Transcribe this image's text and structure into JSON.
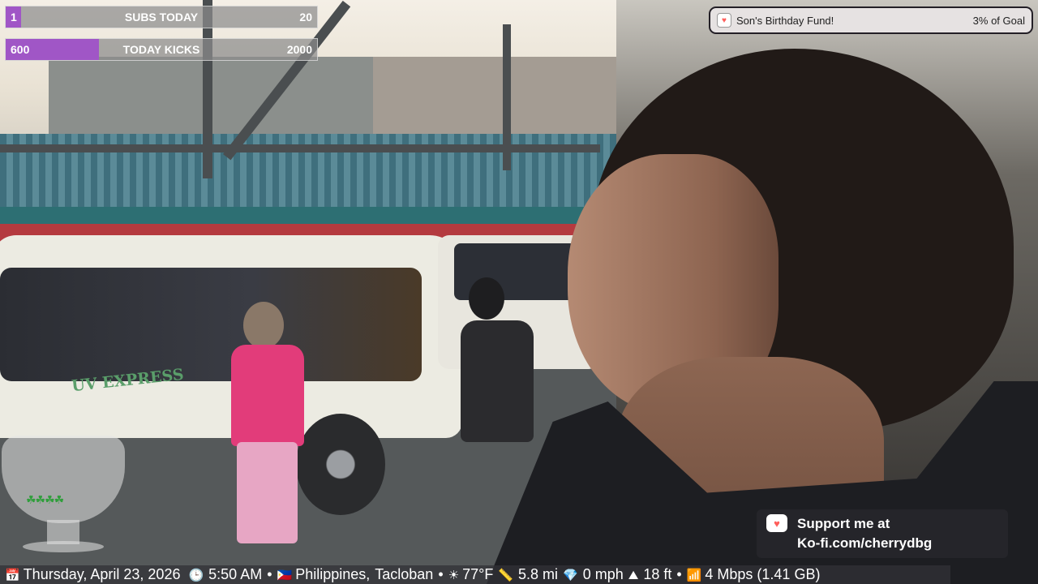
{
  "overlay": {
    "subs_goal": {
      "current": "1",
      "label": "SUBS TODAY",
      "target": "20",
      "fill_fraction": 0.05
    },
    "kicks_goal": {
      "current": "600",
      "label": "TODAY KICKS",
      "target": "2000",
      "fill_fraction": 0.3
    },
    "fund": {
      "icon": "kofi-heart-cup-icon",
      "title": "Son's Birthday Fund!",
      "progress": "3% of Goal"
    },
    "kofi": {
      "icon": "kofi-cup-icon",
      "line1": "Support me at",
      "line2": "Ko-fi.com/cherrydbg"
    },
    "glass": {
      "icon": "clover-glass-icon"
    },
    "status": {
      "date": "Thursday, April 23, 2026",
      "time": "5:50 AM",
      "country": "Philippines,",
      "city": "Tacloban",
      "temp": "77°F",
      "distance": "5.8 mi",
      "speed": "0 mph",
      "altitude": "18 ft",
      "network": "4 Mbps (1.41 GB)",
      "sep": "•"
    }
  },
  "colors": {
    "goal_fill": "#a056c6",
    "kofi_red": "#ff5e5b"
  }
}
